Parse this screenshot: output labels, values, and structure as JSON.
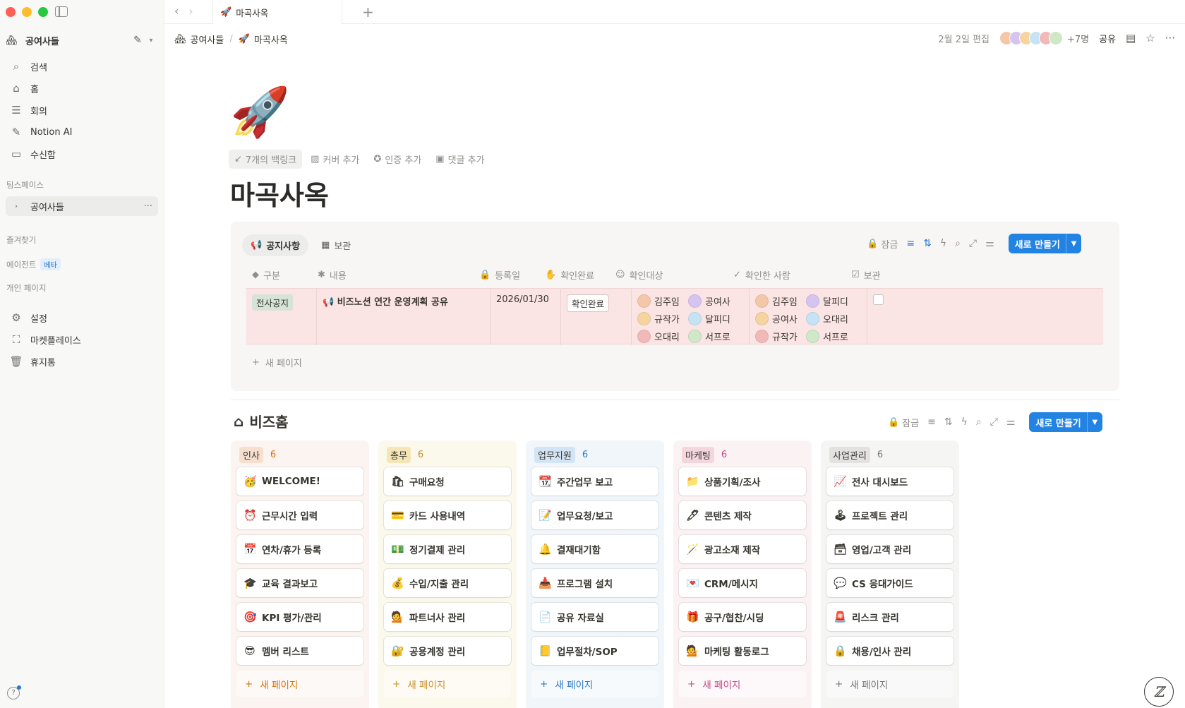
{
  "sidebar": {
    "workspace": {
      "logo": "🏘",
      "name": "공여사들"
    },
    "nav": [
      {
        "icon": "search-icon",
        "glyph": "⌕",
        "label": "검색"
      },
      {
        "icon": "home-icon",
        "glyph": "⌂",
        "label": "홈"
      },
      {
        "icon": "meeting-icon",
        "glyph": "☰",
        "label": "회의"
      },
      {
        "icon": "notion-ai-icon",
        "glyph": "✎",
        "label": "Notion AI"
      },
      {
        "icon": "inbox-icon",
        "glyph": "▭",
        "label": "수신함"
      }
    ],
    "teamspace_label": "팀스페이스",
    "teamspace_item": "공여사들",
    "favorites_label": "즐겨찾기",
    "agents_label": "에이전트",
    "beta_label": "베타",
    "private_label": "개인 페이지",
    "bottom": [
      {
        "icon": "settings-icon",
        "glyph": "⚙",
        "label": "설정"
      },
      {
        "icon": "marketplace-icon",
        "glyph": "⛶",
        "label": "마켓플레이스"
      },
      {
        "icon": "trash-icon",
        "glyph": "🗑",
        "label": "휴지통"
      }
    ]
  },
  "tab": {
    "icon": "🚀",
    "label": "마곡사옥"
  },
  "topbar": {
    "breadcrumb_workspace": "공여사들",
    "breadcrumb_page": "마곡사옥",
    "edited": "2월 2일 편집",
    "more_people": "+7명",
    "share": "공유"
  },
  "page": {
    "icon": "🚀",
    "title": "마곡사옥",
    "actions": {
      "backlinks": "7개의 백링크",
      "add_cover": "커버 추가",
      "add_verify": "인증 추가",
      "add_comment": "댓글 추가"
    }
  },
  "notice_db": {
    "views": [
      "공지사항",
      "보관"
    ],
    "lock_label": "잠금",
    "new_button": "새로 만들기",
    "columns": [
      "구분",
      "내용",
      "등록일",
      "확인완료",
      "확인대상",
      "확인한 사람",
      "보관"
    ],
    "row": {
      "category": "전사공지",
      "content_icon": "📢",
      "content": "비즈노션 연간 운영계획 공유",
      "date": "2026/01/30",
      "status": "확인완료",
      "targets": [
        "김주임",
        "공여사",
        "규작가",
        "달피디",
        "오대리",
        "서프로"
      ],
      "confirmed": [
        "김주임",
        "달피디",
        "공여사",
        "오대리",
        "규작가",
        "서프로"
      ]
    },
    "new_page": "새 페이지"
  },
  "biz_home": {
    "title": "비즈홈",
    "lock_label": "잠금",
    "new_button": "새로 만들기",
    "new_page": "새 페이지",
    "columns": [
      {
        "name": "인사",
        "count": "6",
        "bg": "#fcf4f0",
        "chip": "#f6dfcf",
        "accent": "#d9730d",
        "cards": [
          {
            "e": "🥳",
            "t": "WELCOME!"
          },
          {
            "e": "⏰",
            "t": "근무시간 입력"
          },
          {
            "e": "📅",
            "t": "연차/휴가 등록"
          },
          {
            "e": "🎓",
            "t": "교육 결과보고"
          },
          {
            "e": "🎯",
            "t": "KPI 평가/관리"
          },
          {
            "e": "😎",
            "t": "멤버 리스트"
          }
        ]
      },
      {
        "name": "총무",
        "count": "6",
        "bg": "#fbf8ec",
        "chip": "#f5e6b8",
        "accent": "#cb912f",
        "cards": [
          {
            "e": "🛍",
            "t": "구매요청"
          },
          {
            "e": "💳",
            "t": "카드 사용내역"
          },
          {
            "e": "💵",
            "t": "정기결제 관리"
          },
          {
            "e": "💰",
            "t": "수입/지출 관리"
          },
          {
            "e": "💁",
            "t": "파트너사 관리"
          },
          {
            "e": "🔐",
            "t": "공용계정 관리"
          }
        ]
      },
      {
        "name": "업무지원",
        "count": "6",
        "bg": "#f1f6fb",
        "chip": "#d3e4f5",
        "accent": "#2f7ac1",
        "cards": [
          {
            "e": "📆",
            "t": "주간업무 보고"
          },
          {
            "e": "📝",
            "t": "업무요청/보고"
          },
          {
            "e": "🔔",
            "t": "결재대기함"
          },
          {
            "e": "📥",
            "t": "프로그램 설치"
          },
          {
            "e": "📄",
            "t": "공유 자료실"
          },
          {
            "e": "📒",
            "t": "업무절차/SOP"
          }
        ]
      },
      {
        "name": "마케팅",
        "count": "6",
        "bg": "#fbf2f4",
        "chip": "#f4d6de",
        "accent": "#c14c8a",
        "cards": [
          {
            "e": "📁",
            "t": "상품기획/조사"
          },
          {
            "e": "🖊",
            "t": "콘텐츠 제작"
          },
          {
            "e": "🪄",
            "t": "광고소재 제작"
          },
          {
            "e": "💌",
            "t": "CRM/메시지"
          },
          {
            "e": "🎁",
            "t": "공구/협찬/시딩"
          },
          {
            "e": "💁",
            "t": "마케팅 활동로그"
          }
        ]
      },
      {
        "name": "사업관리",
        "count": "6",
        "bg": "#f5f5f4",
        "chip": "#e3e2e0",
        "accent": "#787774",
        "cards": [
          {
            "e": "📈",
            "t": "전사 대시보드"
          },
          {
            "e": "🕹",
            "t": "프로젝트 관리"
          },
          {
            "e": "🗃",
            "t": "영업/고객 관리"
          },
          {
            "e": "💬",
            "t": "CS 응대가이드"
          },
          {
            "e": "🚨",
            "t": "리스크 관리"
          },
          {
            "e": "🔒",
            "t": "채용/인사 관리"
          }
        ]
      }
    ]
  },
  "avatar_colors": [
    "#f4c7a8",
    "#d5c4f0",
    "#f6d4a0",
    "#c6e3f5",
    "#f2b9b9",
    "#cfe8c8"
  ]
}
